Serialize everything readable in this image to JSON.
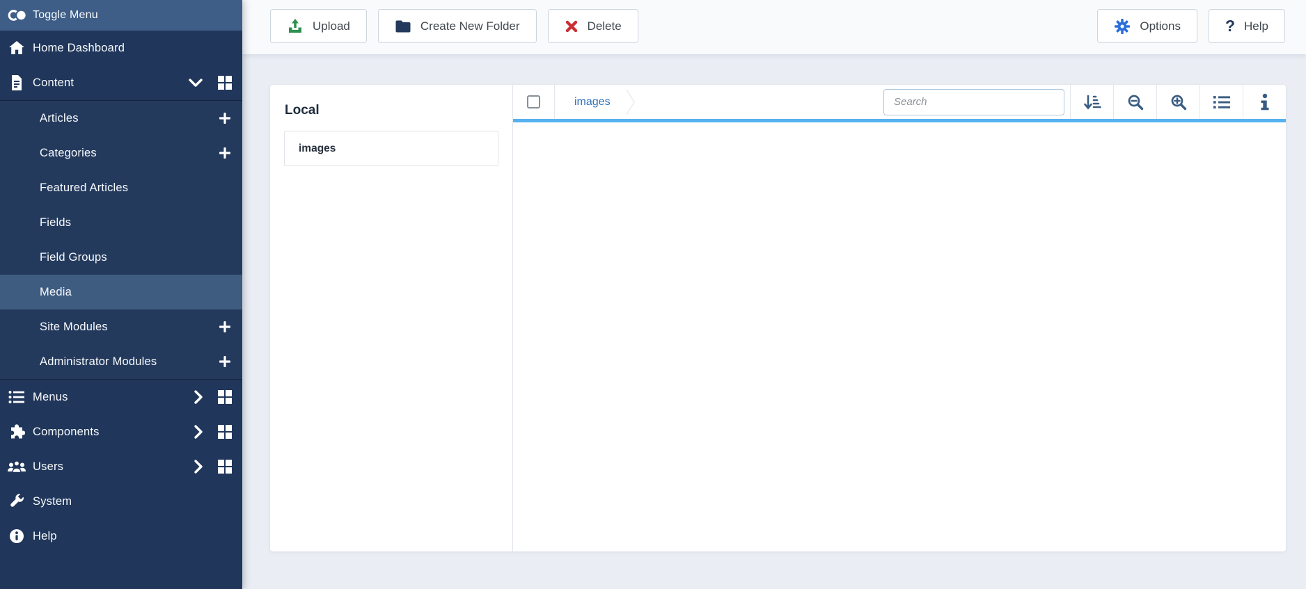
{
  "sidebar": {
    "toggle_label": "Toggle Menu",
    "home_label": "Home Dashboard",
    "content_label": "Content",
    "content_submenu": [
      {
        "label": "Articles"
      },
      {
        "label": "Categories"
      },
      {
        "label": "Featured Articles"
      },
      {
        "label": "Fields"
      },
      {
        "label": "Field Groups"
      },
      {
        "label": "Media"
      },
      {
        "label": "Site Modules"
      },
      {
        "label": "Administrator Modules"
      }
    ],
    "menus_label": "Menus",
    "components_label": "Components",
    "users_label": "Users",
    "system_label": "System",
    "help_label": "Help"
  },
  "toolbar": {
    "upload_label": "Upload",
    "new_folder_label": "Create New Folder",
    "delete_label": "Delete",
    "options_label": "Options",
    "help_label": "Help",
    "help_icon_glyph": "?"
  },
  "media": {
    "drive_label": "Local",
    "tree_item_label": "images",
    "breadcrumb_label": "images",
    "search_placeholder": "Search",
    "toolbar_icons": [
      "sort-amount-down",
      "zoom-out",
      "zoom-in",
      "list-view",
      "info"
    ]
  },
  "colors": {
    "sidebar_bg": "#20365a",
    "sidebar_header_bg": "#3f5e87",
    "sidebar_active_bg": "#3e5b80",
    "accent_underline": "#56b1ee",
    "link_blue": "#2e70ba",
    "upload_green": "#2e8f4e",
    "delete_red": "#cb2e33",
    "options_gear_blue": "#2b6fdb",
    "toolbar_icon_navy": "#3a5c82"
  }
}
